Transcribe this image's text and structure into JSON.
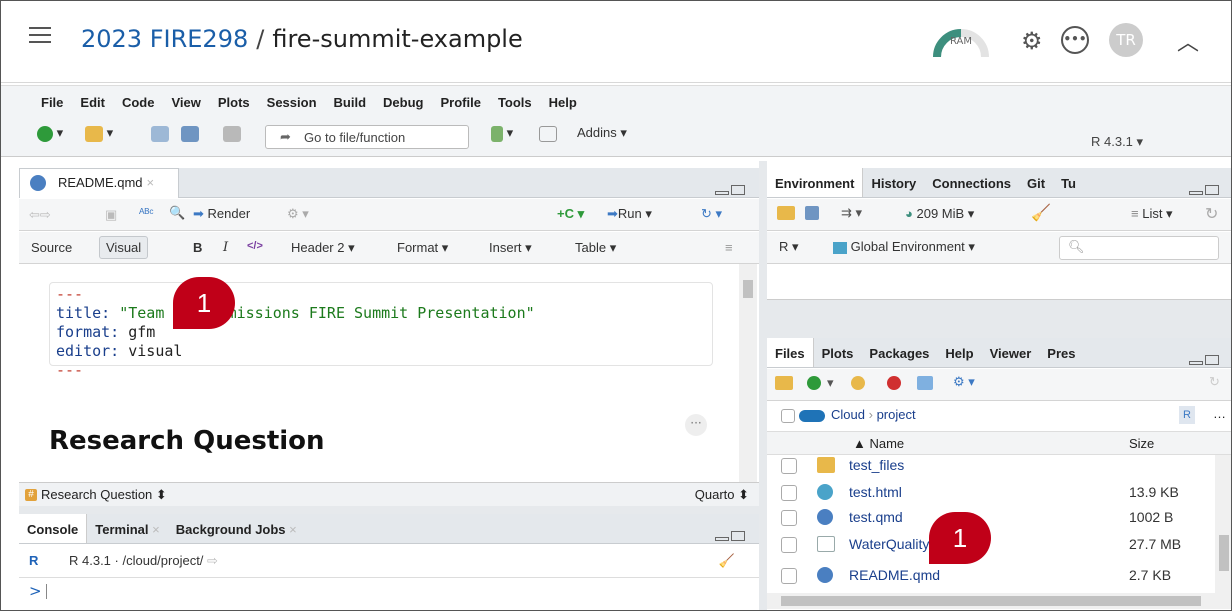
{
  "header": {
    "workspace": "2023 FIRE298",
    "separator": "/",
    "project": "fire-summit-example",
    "ram_label": "RAM",
    "avatar_initials": "TR"
  },
  "menu": [
    "File",
    "Edit",
    "Code",
    "View",
    "Plots",
    "Session",
    "Build",
    "Debug",
    "Profile",
    "Tools",
    "Help"
  ],
  "toolbar": {
    "goto_placeholder": "Go to file/function",
    "addins": "Addins ▾",
    "r_version": "R 4.3.1 ▾"
  },
  "editor": {
    "tab_name": "README.qmd",
    "render": "Render",
    "run": "Run ▾",
    "source": "Source",
    "visual": "Visual",
    "bold": "B",
    "italic": "I",
    "code": "</>",
    "header": "Header 2 ▾",
    "format": "Format ▾",
    "insert": "Insert ▾",
    "table": "Table ▾",
    "yaml_dash": "---",
    "yaml_title_key": "title:",
    "yaml_title_val": "\"Team Zero-Emissions FIRE Summit Presentation\"",
    "yaml_format_key": "format:",
    "yaml_format_val": "gfm",
    "yaml_editor_key": "editor:",
    "yaml_editor_val": "visual",
    "heading": "Research Question",
    "status_section": "Research Question ⬍",
    "status_lang": "Quarto ⬍"
  },
  "console": {
    "tabs": [
      "Console",
      "Terminal",
      "Background Jobs"
    ],
    "r_version": "R 4.3.1",
    "path": "· /cloud/project/",
    "prompt": ">"
  },
  "environment": {
    "tabs": [
      "Environment",
      "History",
      "Connections",
      "Git",
      "Tu"
    ],
    "memory": "209 MiB ▾",
    "list": "List ▾",
    "r_scope": "R ▾",
    "global_env": "Global Environment ▾"
  },
  "files": {
    "tabs": [
      "Files",
      "Plots",
      "Packages",
      "Help",
      "Viewer",
      "Pres"
    ],
    "crumb_cloud": "Cloud",
    "crumb_sep": "›",
    "crumb_project": "project",
    "col_name": "▲ Name",
    "col_size": "Size",
    "rows": [
      {
        "name": "test_files",
        "size": ""
      },
      {
        "name": "test.html",
        "size": "13.9 KB"
      },
      {
        "name": "test.qmd",
        "size": "1002 B"
      },
      {
        "name": "WaterQuality.csv",
        "size": "27.7 MB"
      },
      {
        "name": "README.qmd",
        "size": "2.7 KB"
      }
    ]
  },
  "callouts": {
    "badge1": "1",
    "badge2": "1"
  },
  "colors": {
    "accent_red": "#c00018",
    "link_blue": "#1a3f8c",
    "workspace_blue": "#1a5ea8"
  }
}
